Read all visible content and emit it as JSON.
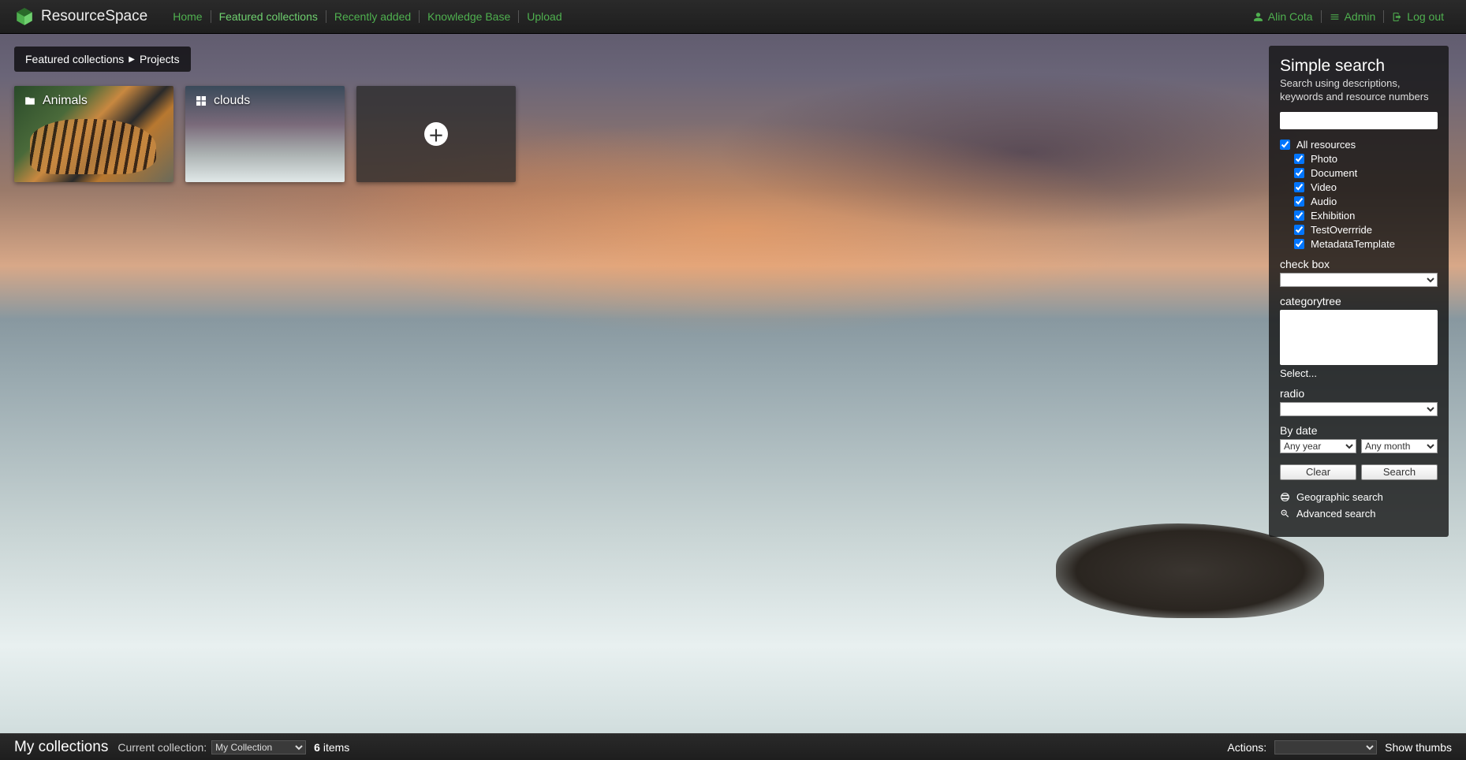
{
  "brand": "ResourceSpace",
  "nav": {
    "home": "Home",
    "featured": "Featured collections",
    "recent": "Recently added",
    "kb": "Knowledge Base",
    "upload": "Upload"
  },
  "user": {
    "name": "Alin Cota",
    "admin": "Admin",
    "logout": "Log out"
  },
  "breadcrumb": {
    "root": "Featured collections",
    "current": "Projects"
  },
  "tiles": {
    "animals": "Animals",
    "clouds": "clouds"
  },
  "search": {
    "title": "Simple search",
    "desc": "Search using descriptions, keywords and resource numbers",
    "all": "All resources",
    "types": [
      "Photo",
      "Document",
      "Video",
      "Audio",
      "Exhibition",
      "TestOverrride",
      "MetadataTemplate"
    ],
    "checkbox_label": "check box",
    "categorytree_label": "categorytree",
    "select_link": "Select...",
    "radio_label": "radio",
    "bydate_label": "By date",
    "any_year": "Any year",
    "any_month": "Any month",
    "clear": "Clear",
    "search_btn": "Search",
    "geo": "Geographic search",
    "advanced": "Advanced search"
  },
  "footer": {
    "title": "My collections",
    "current_label": "Current collection:",
    "current_value": "My Collection",
    "count": "6",
    "items_word": "items",
    "actions_label": "Actions:",
    "show_thumbs": "Show thumbs"
  }
}
